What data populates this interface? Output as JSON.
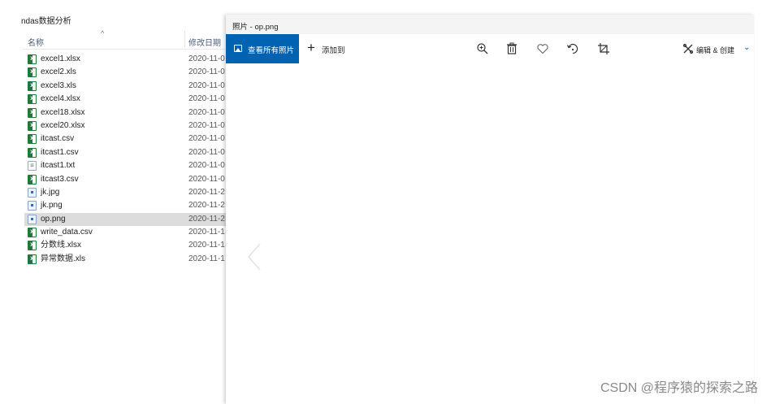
{
  "explorer": {
    "title": "ndas数据分析",
    "col_name": "名称",
    "col_date": "修改日期",
    "sort_caret": "^",
    "files": [
      {
        "name": "excel1.xlsx",
        "date": "2020-11-0",
        "icon": "excel-icon",
        "glyph": "X",
        "type": "excel"
      },
      {
        "name": "excel2.xls",
        "date": "2020-11-0",
        "icon": "excel-icon",
        "glyph": "X",
        "type": "xls"
      },
      {
        "name": "excel3.xls",
        "date": "2020-11-0",
        "icon": "excel-icon",
        "glyph": "X",
        "type": "xls"
      },
      {
        "name": "excel4.xlsx",
        "date": "2020-11-0",
        "icon": "excel-icon",
        "glyph": "X",
        "type": "excel"
      },
      {
        "name": "excel18.xlsx",
        "date": "2020-11-0",
        "icon": "excel-icon",
        "glyph": "X",
        "type": "excel"
      },
      {
        "name": "excel20.xlsx",
        "date": "2020-11-0",
        "icon": "excel-icon",
        "glyph": "X",
        "type": "excel"
      },
      {
        "name": "itcast.csv",
        "date": "2020-11-0",
        "icon": "excel-icon",
        "glyph": "X",
        "type": "excel"
      },
      {
        "name": "itcast1.csv",
        "date": "2020-11-0",
        "icon": "excel-icon",
        "glyph": "X",
        "type": "excel"
      },
      {
        "name": "itcast1.txt",
        "date": "2020-11-0",
        "icon": "text-file-icon",
        "glyph": "≡",
        "type": "txt"
      },
      {
        "name": "itcast3.csv",
        "date": "2020-11-0",
        "icon": "excel-icon",
        "glyph": "X",
        "type": "excel"
      },
      {
        "name": "jk.jpg",
        "date": "2020-11-2",
        "icon": "image-file-icon",
        "glyph": "▪",
        "type": "img"
      },
      {
        "name": "jk.png",
        "date": "2020-11-2",
        "icon": "image-file-icon",
        "glyph": "▪",
        "type": "img"
      },
      {
        "name": "op.png",
        "date": "2020-11-2",
        "icon": "image-file-icon",
        "glyph": "▪",
        "type": "img",
        "selected": true
      },
      {
        "name": "write_data.csv",
        "date": "2020-11-1",
        "icon": "excel-icon",
        "glyph": "X",
        "type": "excel"
      },
      {
        "name": "分数线.xlsx",
        "date": "2020-11-1",
        "icon": "excel-icon",
        "glyph": "X",
        "type": "excel"
      },
      {
        "name": "异常数据.xls",
        "date": "2020-11-1",
        "icon": "excel-icon",
        "glyph": "X",
        "type": "xls"
      }
    ]
  },
  "photos": {
    "title": "照片 - op.png",
    "see_all_label": "查看所有照片",
    "add_label": "添加到",
    "add_glyph": "+",
    "edit_label": "编辑 & 创建",
    "edit_chevron": "⌄",
    "accent": "#0063b1",
    "tools": [
      "zoom-icon",
      "delete-icon",
      "favorite-icon",
      "rotate-icon",
      "crop-icon"
    ]
  },
  "watermark": "CSDN @程序猿的探索之路"
}
